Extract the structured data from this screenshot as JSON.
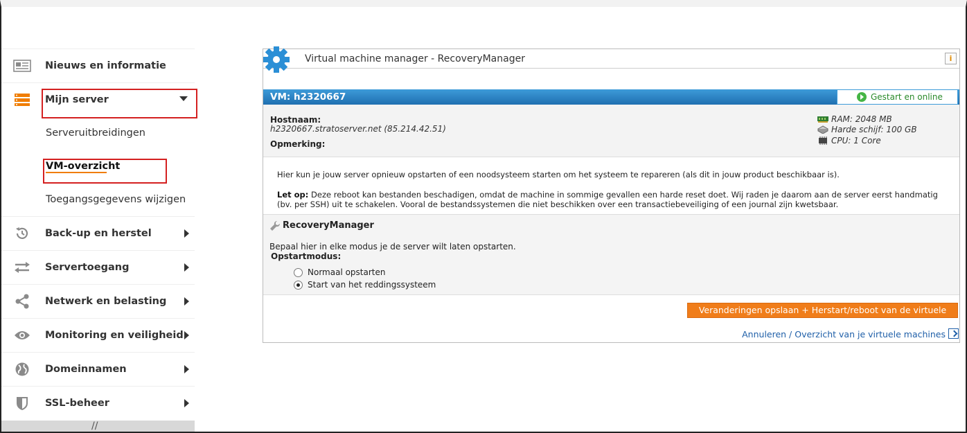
{
  "colors": {
    "accent": "#f07d00",
    "highlight": "#d42020",
    "vm_bar": "#2a80c4",
    "online": "#45b545",
    "button": "#f07d1a",
    "link": "#1f5fa8"
  },
  "sidebar": {
    "items": [
      {
        "label": "Nieuws en informatie",
        "icon": "news-icon"
      },
      {
        "label": "Mijn server",
        "icon": "server-icon",
        "expanded": true,
        "children": [
          "Serveruitbreidingen",
          "VM-overzicht",
          "Toegangsgegevens wijzigen"
        ]
      },
      {
        "label": "Back-up en herstel",
        "icon": "history-icon"
      },
      {
        "label": "Servertoegang",
        "icon": "transfer-icon"
      },
      {
        "label": "Netwerk en belasting",
        "icon": "share-icon"
      },
      {
        "label": "Monitoring en veiligheid",
        "icon": "eye-icon"
      },
      {
        "label": "Domeinnamen",
        "icon": "globe-icon"
      },
      {
        "label": "SSL-beheer",
        "icon": "shield-icon"
      }
    ],
    "bottom_glyph": "//"
  },
  "panel": {
    "title": "Virtual machine manager - RecoveryManager",
    "info_label": "i",
    "vm_name": "VM: h2320667",
    "status": "Gestart en online",
    "hostname_label": "Hostnaam:",
    "hostname_value": "h2320667.stratoserver.net (85.214.42.51)",
    "remark_label": "Opmerking:",
    "specs": [
      {
        "icon": "ram-icon",
        "text": "RAM: 2048 MB"
      },
      {
        "icon": "harddisk-icon",
        "text": "Harde schijf: 100 GB"
      },
      {
        "icon": "cpu-icon",
        "text": "CPU: 1 Core"
      }
    ],
    "intro": "Hier kun je jouw server opnieuw opstarten of een noodsysteem starten om het systeem te repareren (als dit in jouw product beschikbaar is).",
    "warning_label": "Let op:",
    "warning_text": " Deze reboot kan bestanden beschadigen, omdat de machine in sommige gevallen een harde reset doet. Wij raden je daarom aan de server eerst handmatig (bv. per SSH) uit te schakelen. Vooral de bestandssystemen die niet beschikken over een transactiebeveiliging of een journal zijn kwetsbaar.",
    "recovery": {
      "title": "RecoveryManager",
      "description": "Bepaal hier in elke modus je de server wilt laten opstarten.",
      "mode_label": "Opstartmodus:",
      "options": [
        {
          "label": "Normaal opstarten",
          "selected": false
        },
        {
          "label": "Start van het reddingssysteem",
          "selected": true
        }
      ]
    },
    "save_button": "Veranderingen opslaan + Herstart/reboot van de virtuele machine",
    "cancel_link": "Annuleren / Overzicht van je virtuele machines"
  }
}
